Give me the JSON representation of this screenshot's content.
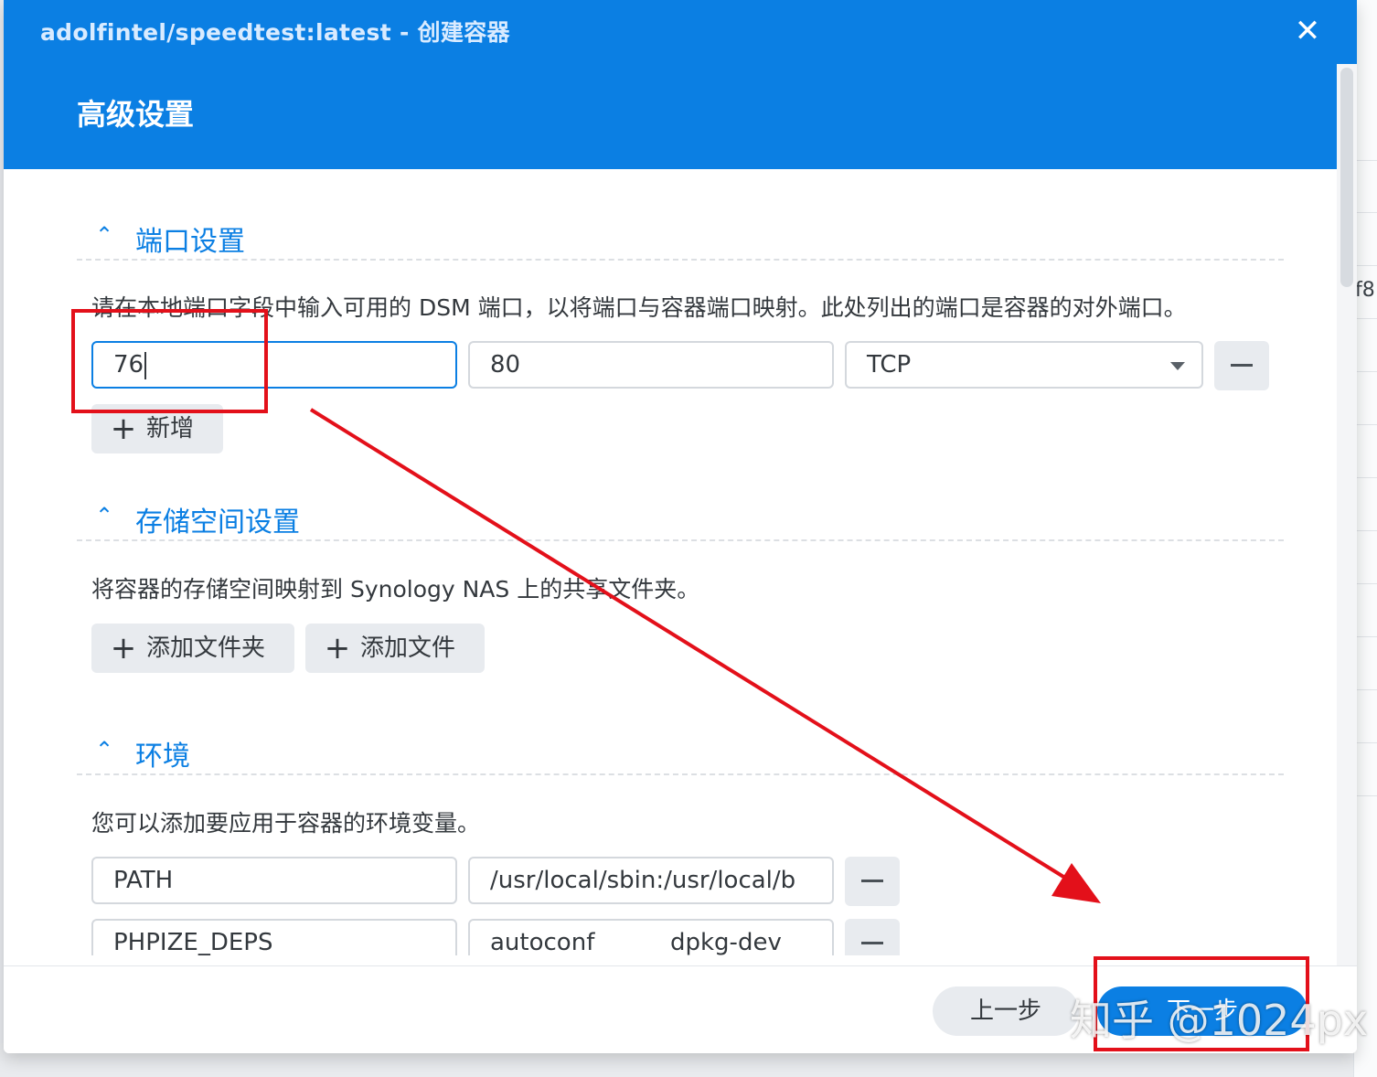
{
  "window": {
    "title": "adolfintel/speedtest:latest - 创建容器",
    "close_icon": "close-icon",
    "page_title": "高级设置"
  },
  "background": {
    "partial_text": "f8"
  },
  "ports": {
    "title": "端口设置",
    "description": "请在本地端口字段中输入可用的 DSM 端口，以将端口与容器端口映射。此处列出的端口是容器的对外端口。",
    "local_port": "76",
    "container_port": "80",
    "protocol": "TCP",
    "add_label": "新增"
  },
  "storage": {
    "title": "存储空间设置",
    "description": "将容器的存储空间映射到 Synology NAS 上的共享文件夹。",
    "add_folder_label": "添加文件夹",
    "add_file_label": "添加文件"
  },
  "env": {
    "title": "环境",
    "description": "您可以添加要应用于容器的环境变量。",
    "rows": [
      {
        "key": "PATH",
        "value": "/usr/local/sbin:/usr/local/b"
      },
      {
        "key": "PHPIZE_DEPS",
        "value": "autoconf          dpkg-dev"
      }
    ]
  },
  "footer": {
    "prev_label": "上一步",
    "next_label": "下一步"
  },
  "annotation": {
    "color": "#e3101a",
    "watermark": "知乎 @1024px"
  },
  "colors": {
    "accent": "#0b7fe3",
    "button_bg": "#e8ebef"
  }
}
